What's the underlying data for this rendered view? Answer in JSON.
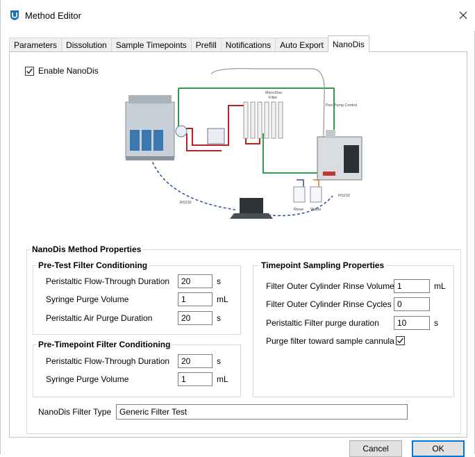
{
  "window": {
    "title": "Method Editor"
  },
  "tabs": [
    {
      "label": "Parameters"
    },
    {
      "label": "Dissolution"
    },
    {
      "label": "Sample Timepoints"
    },
    {
      "label": "Prefill"
    },
    {
      "label": "Notifications"
    },
    {
      "label": "Auto Export"
    },
    {
      "label": "NanoDis",
      "active": true
    }
  ],
  "enable": {
    "label": "Enable NanoDis",
    "checked": true
  },
  "diagram": {
    "labels": {
      "microdis_filter_1": "MicroDiss",
      "microdis_filter_2": "Filter",
      "peri_pump": "Peri-Pump Control",
      "rs232_left": "RS232",
      "rs232_right": "RS232",
      "rinse": "Rinse",
      "waste": "Waste"
    }
  },
  "properties": {
    "title": "NanoDis Method Properties",
    "pre_test": {
      "title": "Pre-Test Filter Conditioning",
      "fields": [
        {
          "label": "Peristaltic Flow-Through Duration",
          "value": "20",
          "unit": "s"
        },
        {
          "label": "Syringe Purge Volume",
          "value": "1",
          "unit": "mL"
        },
        {
          "label": "Peristaltic Air Purge Duration",
          "value": "20",
          "unit": "s"
        }
      ]
    },
    "pre_timepoint": {
      "title": "Pre-Timepoint Filter Conditioning",
      "fields": [
        {
          "label": "Peristaltic Flow-Through Duration",
          "value": "20",
          "unit": "s"
        },
        {
          "label": "Syringe Purge Volume",
          "value": "1",
          "unit": "mL"
        }
      ]
    },
    "timepoint": {
      "title": "Timepoint Sampling Properties",
      "fields": [
        {
          "label": "Filter Outer Cylinder Rinse Volume",
          "value": "1",
          "unit": "mL"
        },
        {
          "label": "Filter Outer Cylinder Rinse Cycles",
          "value": "0",
          "unit": ""
        },
        {
          "label": "Peristaltic Filter purge duration",
          "value": "10",
          "unit": "s"
        }
      ],
      "purge_toward": {
        "label": "Purge filter toward sample cannula",
        "checked": true
      }
    },
    "filter_type": {
      "label": "NanoDis Filter Type",
      "value": "Generic Filter Test"
    }
  },
  "buttons": {
    "cancel": "Cancel",
    "ok": "OK"
  },
  "colors": {
    "accent": "#0078d7",
    "tube_red": "#b22222",
    "tube_green": "#2e9e4b",
    "tube_blue": "#2b4f9e"
  }
}
